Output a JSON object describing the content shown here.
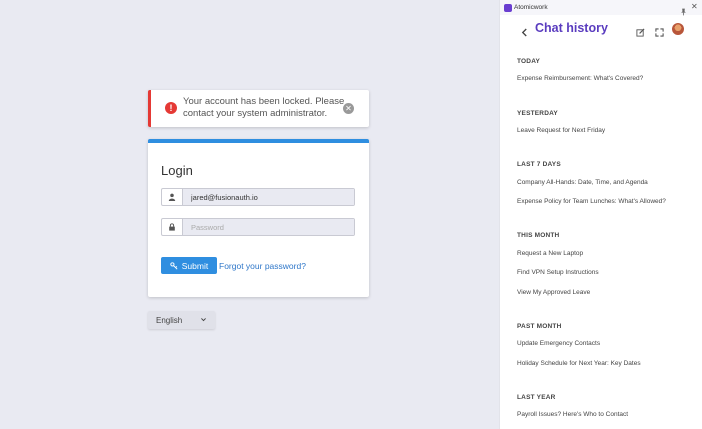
{
  "login": {
    "alert": {
      "message": "Your account has been locked. Please contact your system administrator."
    },
    "title": "Login",
    "email_value": "jared@fusionauth.io",
    "password_placeholder": "Password",
    "submit_label": "Submit",
    "forgot_label": "Forgot your password?",
    "language": "English"
  },
  "panel": {
    "app_name": "Atomicwork",
    "title": "Chat history",
    "sections": [
      {
        "heading": "TODAY",
        "items": [
          "Expense Reimbursement: What's Covered?"
        ]
      },
      {
        "heading": "YESTERDAY",
        "items": [
          "Leave Request for Next Friday"
        ]
      },
      {
        "heading": "LAST 7 DAYS",
        "items": [
          "Company All-Hands: Date, Time, and Agenda",
          "Expense Policy for Team Lunches: What's Allowed?"
        ]
      },
      {
        "heading": "THIS MONTH",
        "items": [
          "Request a New Laptop",
          "Find VPN Setup Instructions",
          "View My Approved Leave"
        ]
      },
      {
        "heading": "PAST MONTH",
        "items": [
          "Update Emergency Contacts",
          "Holiday Schedule for Next Year: Key Dates"
        ]
      },
      {
        "heading": "LAST YEAR",
        "items": [
          "Payroll Issues? Here's Who to Contact"
        ]
      }
    ]
  },
  "colors": {
    "accent": "#2f8ee0",
    "error": "#e53935",
    "brand": "#5a3cbf"
  }
}
